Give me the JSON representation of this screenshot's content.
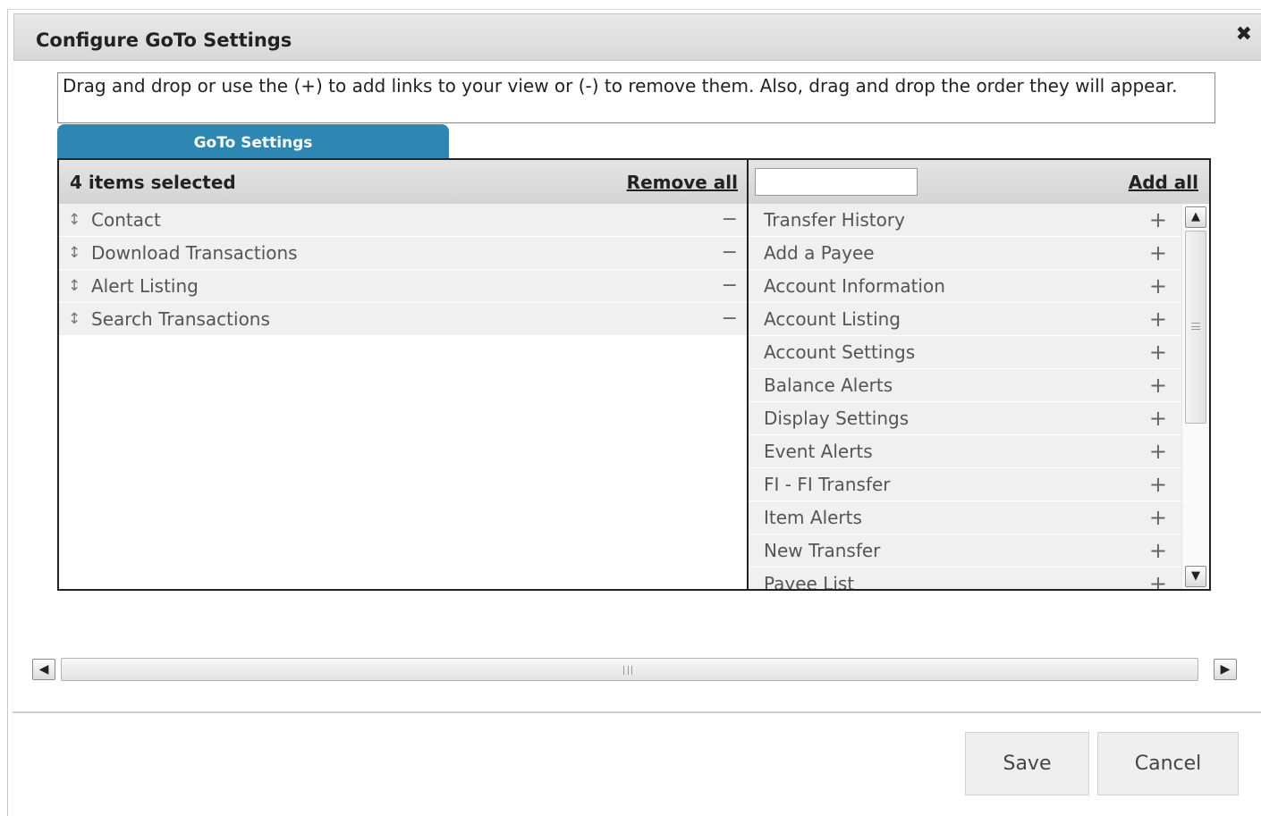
{
  "dialog": {
    "title": "Configure GoTo Settings",
    "close_glyph": "✖"
  },
  "instructions": "Drag and drop or use the (+) to add links to your view or (-) to remove them. Also, drag and drop the order they will appear.",
  "tab": {
    "label": "GoTo Settings"
  },
  "selected": {
    "count_label": "4 items selected",
    "remove_all_label": "Remove all",
    "items": [
      {
        "label": "Contact",
        "grip": "↕",
        "action": "−"
      },
      {
        "label": "Download Transactions",
        "grip": "↕",
        "action": "−"
      },
      {
        "label": "Alert Listing",
        "grip": "↕",
        "action": "−"
      },
      {
        "label": "Search Transactions",
        "grip": "↕",
        "action": "−"
      }
    ]
  },
  "available": {
    "filter_value": "",
    "filter_placeholder": "",
    "add_all_label": "Add all",
    "items": [
      {
        "label": "Transfer History",
        "action": "+"
      },
      {
        "label": "Add a Payee",
        "action": "+"
      },
      {
        "label": "Account Information",
        "action": "+"
      },
      {
        "label": "Account Listing",
        "action": "+"
      },
      {
        "label": "Account Settings",
        "action": "+"
      },
      {
        "label": "Balance Alerts",
        "action": "+"
      },
      {
        "label": "Display Settings",
        "action": "+"
      },
      {
        "label": "Event Alerts",
        "action": "+"
      },
      {
        "label": "FI - FI Transfer",
        "action": "+"
      },
      {
        "label": "Item Alerts",
        "action": "+"
      },
      {
        "label": "New Transfer",
        "action": "+"
      },
      {
        "label": "Payee List",
        "action": "+"
      }
    ]
  },
  "scrollbars": {
    "up_glyph": "▲",
    "down_glyph": "▼",
    "left_glyph": "◀",
    "right_glyph": "▶"
  },
  "footer": {
    "save_label": "Save",
    "cancel_label": "Cancel"
  },
  "colors": {
    "tab_bg": "#2d87b2",
    "header_bg": "#dcdcdc",
    "row_bg": "#f0f0f0"
  }
}
